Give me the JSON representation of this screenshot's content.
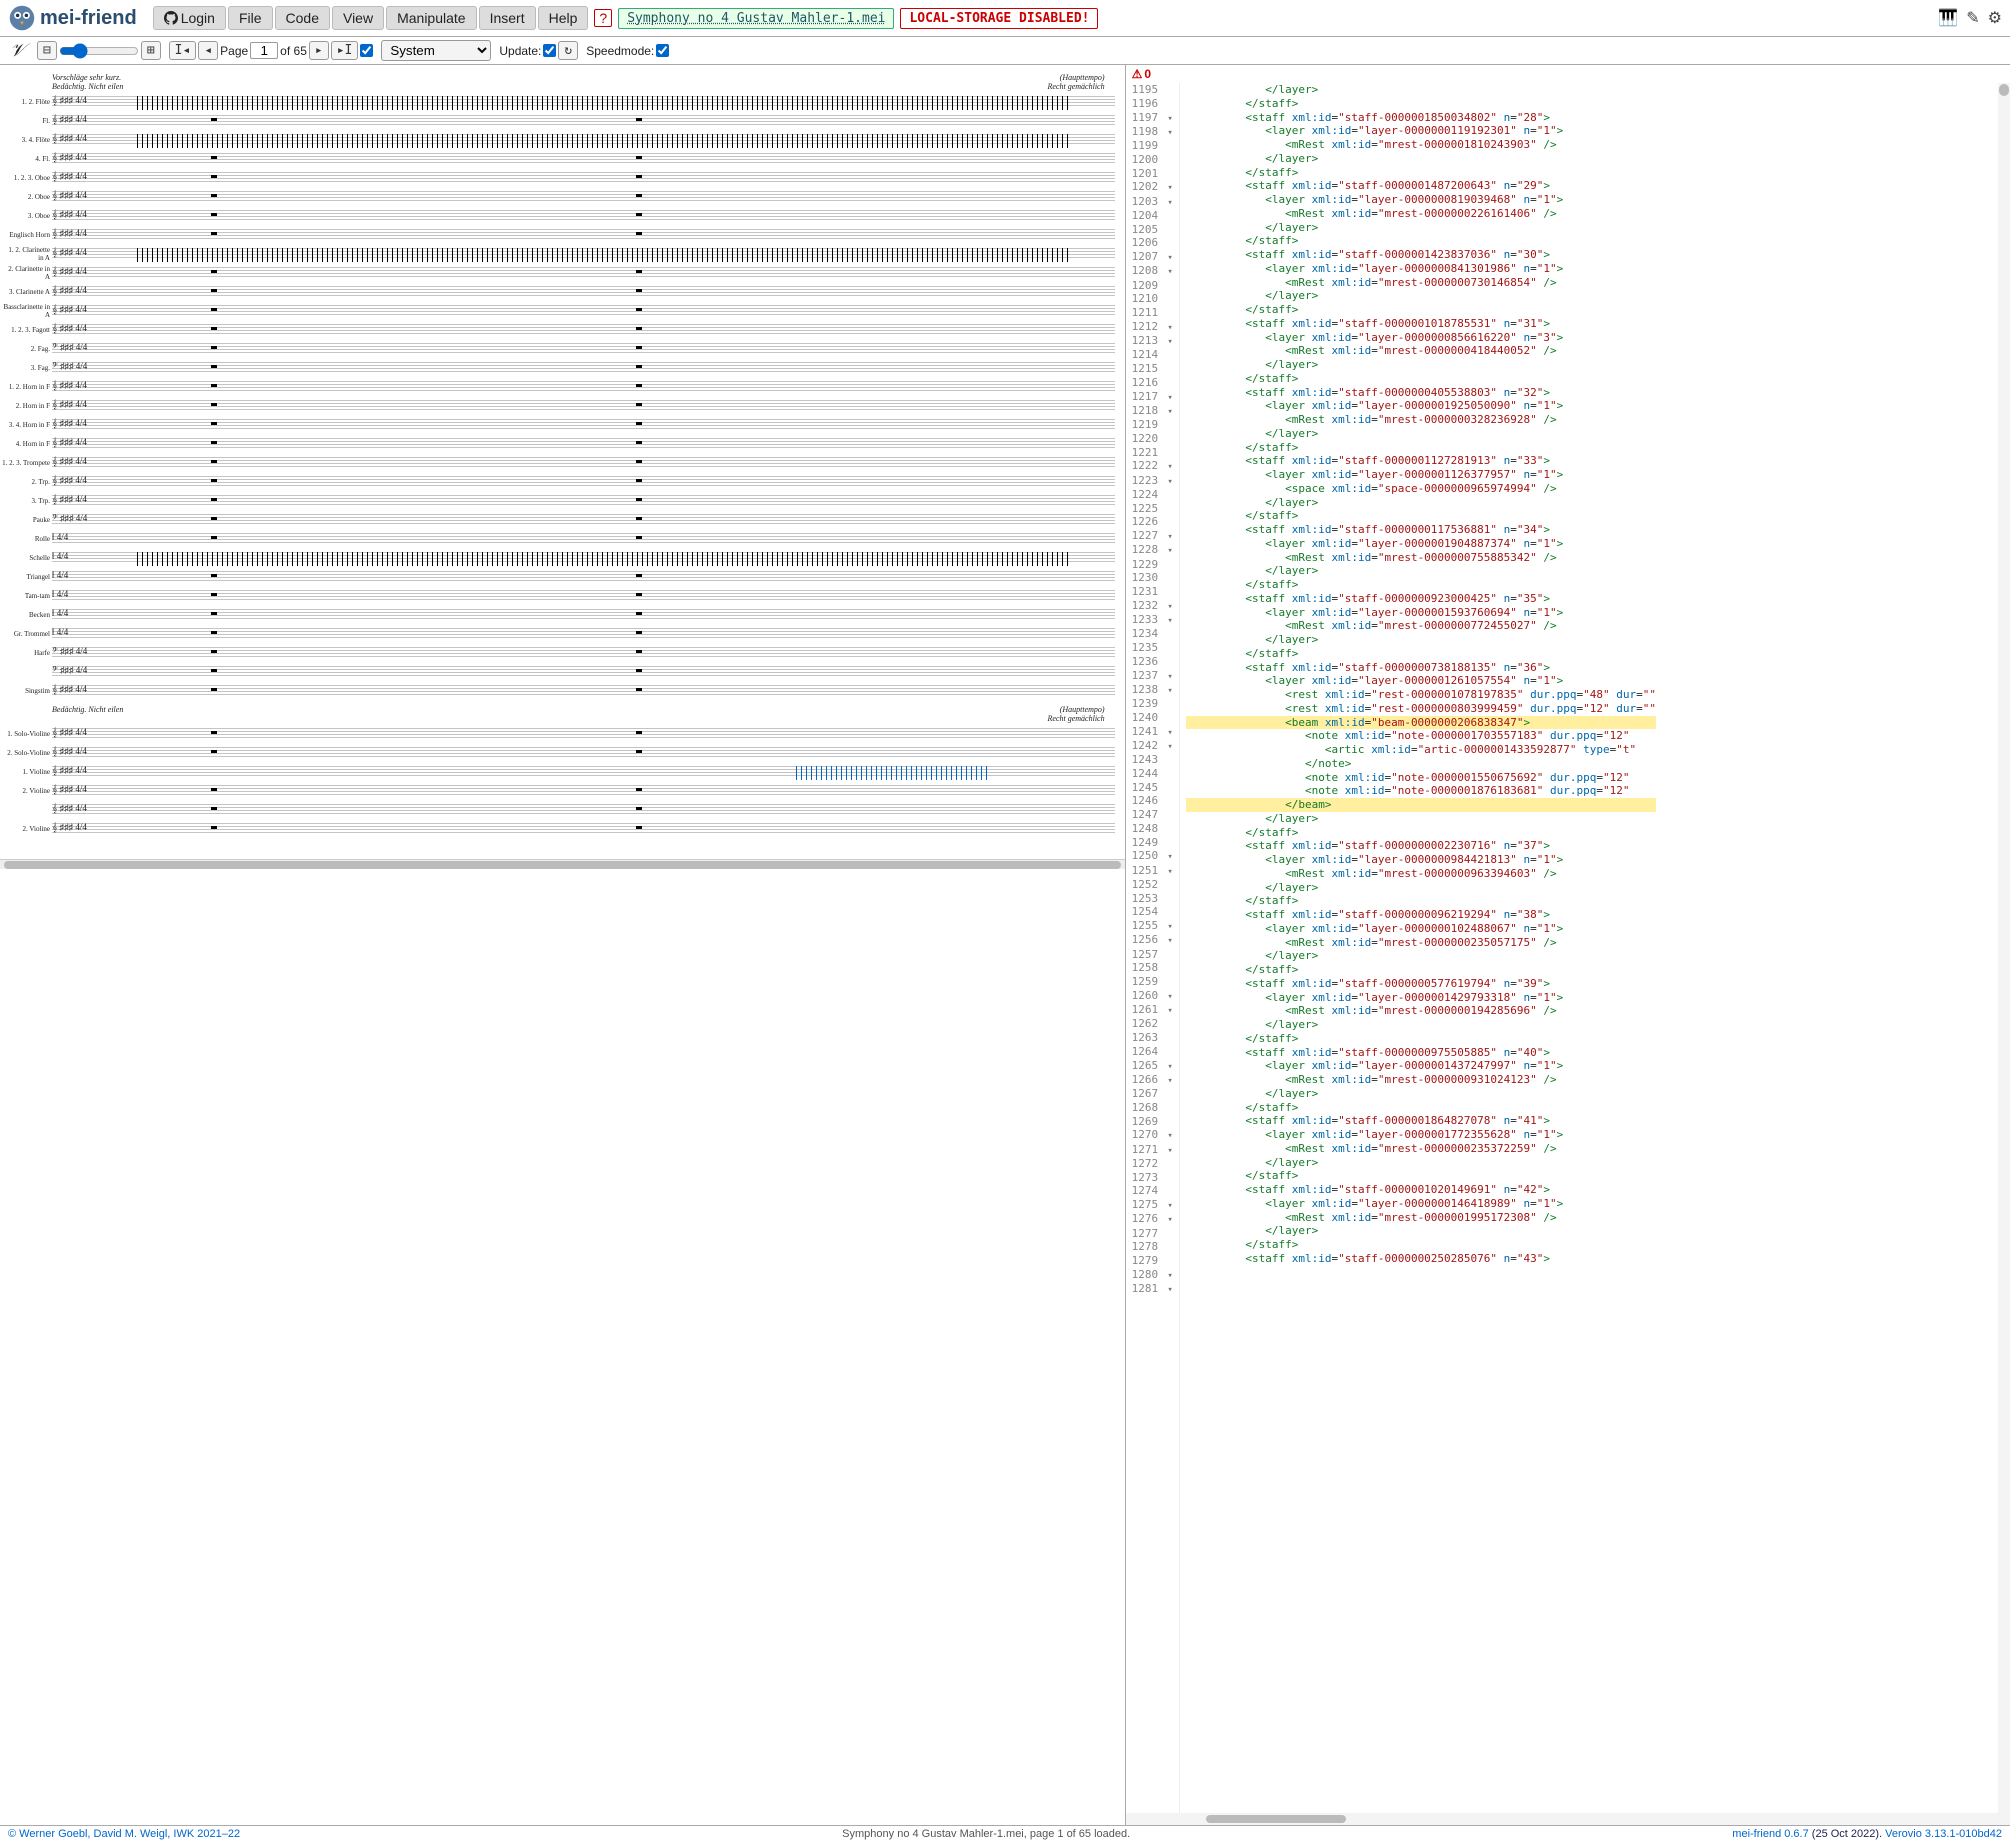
{
  "app_name": "mei-friend",
  "login_label": "Login",
  "menu": [
    "File",
    "Code",
    "View",
    "Manipulate",
    "Insert",
    "Help"
  ],
  "warn_glyph": "?",
  "filename": "Symphony no 4 Gustav Mahler-1.mei",
  "storage_warning": "LOCAL-STORAGE DISABLED!",
  "toolbar": {
    "page_label": "Page",
    "page_value": "1",
    "page_of": "of 65",
    "layout_options": [
      "System"
    ],
    "layout_selected": "System",
    "update_label": "Update:",
    "speed_label": "Speedmode:"
  },
  "errors": {
    "count": "0",
    "glyph": "⚠"
  },
  "tempo_marks": {
    "top_left": "Vorschläge sehr kurz.\nBedächtig. Nicht eilen",
    "top_right": "(Haupttempo)\nRecht gemächlich",
    "mid_left": "Bedächtig. Nicht eilen",
    "mid_right": "(Haupttempo)\nRecht gemächlich"
  },
  "staff_labels": [
    "1. 2. Flöte",
    "Fl.",
    "3. 4. Flöte",
    "4. Fl.",
    "1. 2. 3. Oboe",
    "2. Oboe",
    "3. Oboe",
    "Englisch Horn",
    "1. 2. Clarinette in A",
    "2. Clarinette in A",
    "3. Clarinette A",
    "Bassclarinette in A",
    "1. 2. 3. Fagott",
    "2. Fag.",
    "3. Fag.",
    "1. 2. Horn in F",
    "2. Horn in F",
    "3. 4. Horn in F",
    "4. Horn in F",
    "1. 2. 3. Trompete",
    "2. Trp.",
    "3. Trp.",
    "Pauke",
    "Rolle",
    "Schelle",
    "Triangel",
    "Tam-tam",
    "Becken",
    "Gr. Trommel",
    "Harfe",
    "",
    "Singstim",
    "1. Solo-Violine",
    "2. Solo-Violine",
    "1. Violine",
    "2. Violine",
    "",
    "2. Violine"
  ],
  "code_lines": [
    {
      "n": 1195,
      "indent": 4,
      "html": "</layer>"
    },
    {
      "n": 1196,
      "indent": 3,
      "html": "</staff>"
    },
    {
      "n": 1197,
      "fold": true,
      "indent": 3,
      "tag": "open",
      "el": "staff",
      "attrs": [
        [
          "xml:id",
          "staff-0000001850034802"
        ],
        [
          "n",
          "28"
        ]
      ]
    },
    {
      "n": 1198,
      "fold": true,
      "indent": 4,
      "tag": "open",
      "el": "layer",
      "attrs": [
        [
          "xml:id",
          "layer-0000000119192301"
        ],
        [
          "n",
          "1"
        ]
      ]
    },
    {
      "n": 1199,
      "indent": 5,
      "tag": "self",
      "el": "mRest",
      "attrs": [
        [
          "xml:id",
          "mrest-0000001810243903"
        ]
      ]
    },
    {
      "n": 1200,
      "indent": 4,
      "html": "</layer>"
    },
    {
      "n": 1201,
      "indent": 3,
      "html": "</staff>"
    },
    {
      "n": 1202,
      "fold": true,
      "indent": 3,
      "tag": "open",
      "el": "staff",
      "attrs": [
        [
          "xml:id",
          "staff-0000001487200643"
        ],
        [
          "n",
          "29"
        ]
      ]
    },
    {
      "n": 1203,
      "fold": true,
      "indent": 4,
      "tag": "open",
      "el": "layer",
      "attrs": [
        [
          "xml:id",
          "layer-0000000819039468"
        ],
        [
          "n",
          "1"
        ]
      ]
    },
    {
      "n": 1204,
      "indent": 5,
      "tag": "self",
      "el": "mRest",
      "attrs": [
        [
          "xml:id",
          "mrest-0000000226161406"
        ]
      ]
    },
    {
      "n": 1205,
      "indent": 4,
      "html": "</layer>"
    },
    {
      "n": 1206,
      "indent": 3,
      "html": "</staff>"
    },
    {
      "n": 1207,
      "fold": true,
      "indent": 3,
      "tag": "open",
      "el": "staff",
      "attrs": [
        [
          "xml:id",
          "staff-0000001423837036"
        ],
        [
          "n",
          "30"
        ]
      ]
    },
    {
      "n": 1208,
      "fold": true,
      "indent": 4,
      "tag": "open",
      "el": "layer",
      "attrs": [
        [
          "xml:id",
          "layer-0000000841301986"
        ],
        [
          "n",
          "1"
        ]
      ]
    },
    {
      "n": 1209,
      "indent": 5,
      "tag": "self",
      "el": "mRest",
      "attrs": [
        [
          "xml:id",
          "mrest-0000000730146854"
        ]
      ]
    },
    {
      "n": 1210,
      "indent": 4,
      "html": "</layer>"
    },
    {
      "n": 1211,
      "indent": 3,
      "html": "</staff>"
    },
    {
      "n": 1212,
      "fold": true,
      "indent": 3,
      "tag": "open",
      "el": "staff",
      "attrs": [
        [
          "xml:id",
          "staff-0000001018785531"
        ],
        [
          "n",
          "31"
        ]
      ]
    },
    {
      "n": 1213,
      "fold": true,
      "indent": 4,
      "tag": "open",
      "el": "layer",
      "attrs": [
        [
          "xml:id",
          "layer-0000000856616220"
        ],
        [
          "n",
          "3"
        ]
      ]
    },
    {
      "n": 1214,
      "indent": 5,
      "tag": "self",
      "el": "mRest",
      "attrs": [
        [
          "xml:id",
          "mrest-0000000418440052"
        ]
      ]
    },
    {
      "n": 1215,
      "indent": 4,
      "html": "</layer>"
    },
    {
      "n": 1216,
      "indent": 3,
      "html": "</staff>"
    },
    {
      "n": 1217,
      "fold": true,
      "indent": 3,
      "tag": "open",
      "el": "staff",
      "attrs": [
        [
          "xml:id",
          "staff-0000000405538803"
        ],
        [
          "n",
          "32"
        ]
      ]
    },
    {
      "n": 1218,
      "fold": true,
      "indent": 4,
      "tag": "open",
      "el": "layer",
      "attrs": [
        [
          "xml:id",
          "layer-0000001925050090"
        ],
        [
          "n",
          "1"
        ]
      ]
    },
    {
      "n": 1219,
      "indent": 5,
      "tag": "self",
      "el": "mRest",
      "attrs": [
        [
          "xml:id",
          "mrest-0000000328236928"
        ]
      ]
    },
    {
      "n": 1220,
      "indent": 4,
      "html": "</layer>"
    },
    {
      "n": 1221,
      "indent": 3,
      "html": "</staff>"
    },
    {
      "n": 1222,
      "fold": true,
      "indent": 3,
      "tag": "open",
      "el": "staff",
      "attrs": [
        [
          "xml:id",
          "staff-0000001127281913"
        ],
        [
          "n",
          "33"
        ]
      ]
    },
    {
      "n": 1223,
      "fold": true,
      "indent": 4,
      "tag": "open",
      "el": "layer",
      "attrs": [
        [
          "xml:id",
          "layer-0000001126377957"
        ],
        [
          "n",
          "1"
        ]
      ]
    },
    {
      "n": 1224,
      "indent": 5,
      "tag": "self",
      "el": "space",
      "attrs": [
        [
          "xml:id",
          "space-0000000965974994"
        ]
      ]
    },
    {
      "n": 1225,
      "indent": 4,
      "html": "</layer>"
    },
    {
      "n": 1226,
      "indent": 3,
      "html": "</staff>"
    },
    {
      "n": 1227,
      "fold": true,
      "indent": 3,
      "tag": "open",
      "el": "staff",
      "attrs": [
        [
          "xml:id",
          "staff-0000000117536881"
        ],
        [
          "n",
          "34"
        ]
      ]
    },
    {
      "n": 1228,
      "fold": true,
      "indent": 4,
      "tag": "open",
      "el": "layer",
      "attrs": [
        [
          "xml:id",
          "layer-0000001904887374"
        ],
        [
          "n",
          "1"
        ]
      ]
    },
    {
      "n": 1229,
      "indent": 5,
      "tag": "self",
      "el": "mRest",
      "attrs": [
        [
          "xml:id",
          "mrest-0000000755885342"
        ]
      ]
    },
    {
      "n": 1230,
      "indent": 4,
      "html": "</layer>"
    },
    {
      "n": 1231,
      "indent": 3,
      "html": "</staff>"
    },
    {
      "n": 1232,
      "fold": true,
      "indent": 3,
      "tag": "open",
      "el": "staff",
      "attrs": [
        [
          "xml:id",
          "staff-0000000923000425"
        ],
        [
          "n",
          "35"
        ]
      ]
    },
    {
      "n": 1233,
      "fold": true,
      "indent": 4,
      "tag": "open",
      "el": "layer",
      "attrs": [
        [
          "xml:id",
          "layer-0000001593760694"
        ],
        [
          "n",
          "1"
        ]
      ]
    },
    {
      "n": 1234,
      "indent": 5,
      "tag": "self",
      "el": "mRest",
      "attrs": [
        [
          "xml:id",
          "mrest-0000000772455027"
        ]
      ]
    },
    {
      "n": 1235,
      "indent": 4,
      "html": "</layer>"
    },
    {
      "n": 1236,
      "indent": 3,
      "html": "</staff>"
    },
    {
      "n": 1237,
      "fold": true,
      "indent": 3,
      "tag": "open",
      "el": "staff",
      "attrs": [
        [
          "xml:id",
          "staff-0000000738188135"
        ],
        [
          "n",
          "36"
        ]
      ]
    },
    {
      "n": 1238,
      "fold": true,
      "indent": 4,
      "tag": "open",
      "el": "layer",
      "attrs": [
        [
          "xml:id",
          "layer-0000001261057554"
        ],
        [
          "n",
          "1"
        ]
      ]
    },
    {
      "n": 1239,
      "indent": 5,
      "tag": "open_trail",
      "el": "rest",
      "attrs": [
        [
          "xml:id",
          "rest-0000001078197835"
        ],
        [
          "dur.ppq",
          "48"
        ],
        [
          "dur",
          ""
        ]
      ],
      "trail": true
    },
    {
      "n": 1240,
      "indent": 5,
      "tag": "open_trail",
      "el": "rest",
      "attrs": [
        [
          "xml:id",
          "rest-0000000803999459"
        ],
        [
          "dur.ppq",
          "12"
        ],
        [
          "dur",
          ""
        ]
      ],
      "trail": true
    },
    {
      "n": 1241,
      "fold": true,
      "indent": 5,
      "hl": true,
      "tag": "open",
      "el": "beam",
      "attrs": [
        [
          "xml:id",
          "beam-0000000206838347"
        ]
      ]
    },
    {
      "n": 1242,
      "fold": true,
      "indent": 6,
      "tag": "open_trail",
      "el": "note",
      "attrs": [
        [
          "xml:id",
          "note-0000001703557183"
        ],
        [
          "dur.ppq",
          "12"
        ]
      ],
      "trail": true
    },
    {
      "n": 1243,
      "indent": 7,
      "tag": "open_trail",
      "el": "artic",
      "attrs": [
        [
          "xml:id",
          "artic-0000001433592877"
        ],
        [
          "type",
          "t"
        ]
      ],
      "trail": true
    },
    {
      "n": 1244,
      "indent": 6,
      "html": "</note>"
    },
    {
      "n": 1245,
      "indent": 6,
      "tag": "open_trail",
      "el": "note",
      "attrs": [
        [
          "xml:id",
          "note-0000001550675692"
        ],
        [
          "dur.ppq",
          "12"
        ]
      ],
      "trail": true
    },
    {
      "n": 1246,
      "indent": 6,
      "tag": "open_trail",
      "el": "note",
      "attrs": [
        [
          "xml:id",
          "note-0000001876183681"
        ],
        [
          "dur.ppq",
          "12"
        ]
      ],
      "trail": true
    },
    {
      "n": 1247,
      "indent": 5,
      "hl": true,
      "html": "</beam>"
    },
    {
      "n": 1248,
      "indent": 4,
      "html": "</layer>"
    },
    {
      "n": 1249,
      "indent": 3,
      "html": "</staff>"
    },
    {
      "n": 1250,
      "fold": true,
      "indent": 3,
      "tag": "open",
      "el": "staff",
      "attrs": [
        [
          "xml:id",
          "staff-0000000002230716"
        ],
        [
          "n",
          "37"
        ]
      ]
    },
    {
      "n": 1251,
      "fold": true,
      "indent": 4,
      "tag": "open",
      "el": "layer",
      "attrs": [
        [
          "xml:id",
          "layer-0000000984421813"
        ],
        [
          "n",
          "1"
        ]
      ]
    },
    {
      "n": 1252,
      "indent": 5,
      "tag": "self",
      "el": "mRest",
      "attrs": [
        [
          "xml:id",
          "mrest-0000000963394603"
        ]
      ]
    },
    {
      "n": 1253,
      "indent": 4,
      "html": "</layer>"
    },
    {
      "n": 1254,
      "indent": 3,
      "html": "</staff>"
    },
    {
      "n": 1255,
      "fold": true,
      "indent": 3,
      "tag": "open",
      "el": "staff",
      "attrs": [
        [
          "xml:id",
          "staff-0000000096219294"
        ],
        [
          "n",
          "38"
        ]
      ]
    },
    {
      "n": 1256,
      "fold": true,
      "indent": 4,
      "tag": "open",
      "el": "layer",
      "attrs": [
        [
          "xml:id",
          "layer-0000000102488067"
        ],
        [
          "n",
          "1"
        ]
      ]
    },
    {
      "n": 1257,
      "indent": 5,
      "tag": "self",
      "el": "mRest",
      "attrs": [
        [
          "xml:id",
          "mrest-0000000235057175"
        ]
      ]
    },
    {
      "n": 1258,
      "indent": 4,
      "html": "</layer>"
    },
    {
      "n": 1259,
      "indent": 3,
      "html": "</staff>"
    },
    {
      "n": 1260,
      "fold": true,
      "indent": 3,
      "tag": "open",
      "el": "staff",
      "attrs": [
        [
          "xml:id",
          "staff-0000000577619794"
        ],
        [
          "n",
          "39"
        ]
      ]
    },
    {
      "n": 1261,
      "fold": true,
      "indent": 4,
      "tag": "open",
      "el": "layer",
      "attrs": [
        [
          "xml:id",
          "layer-0000001429793318"
        ],
        [
          "n",
          "1"
        ]
      ]
    },
    {
      "n": 1262,
      "indent": 5,
      "tag": "self",
      "el": "mRest",
      "attrs": [
        [
          "xml:id",
          "mrest-0000000194285696"
        ]
      ]
    },
    {
      "n": 1263,
      "indent": 4,
      "html": "</layer>"
    },
    {
      "n": 1264,
      "indent": 3,
      "html": "</staff>"
    },
    {
      "n": 1265,
      "fold": true,
      "indent": 3,
      "tag": "open",
      "el": "staff",
      "attrs": [
        [
          "xml:id",
          "staff-0000000975505885"
        ],
        [
          "n",
          "40"
        ]
      ]
    },
    {
      "n": 1266,
      "fold": true,
      "indent": 4,
      "tag": "open",
      "el": "layer",
      "attrs": [
        [
          "xml:id",
          "layer-0000001437247997"
        ],
        [
          "n",
          "1"
        ]
      ]
    },
    {
      "n": 1267,
      "indent": 5,
      "tag": "self",
      "el": "mRest",
      "attrs": [
        [
          "xml:id",
          "mrest-0000000931024123"
        ]
      ]
    },
    {
      "n": 1268,
      "indent": 4,
      "html": "</layer>"
    },
    {
      "n": 1269,
      "indent": 3,
      "html": "</staff>"
    },
    {
      "n": 1270,
      "fold": true,
      "indent": 3,
      "tag": "open",
      "el": "staff",
      "attrs": [
        [
          "xml:id",
          "staff-0000001864827078"
        ],
        [
          "n",
          "41"
        ]
      ]
    },
    {
      "n": 1271,
      "fold": true,
      "indent": 4,
      "tag": "open",
      "el": "layer",
      "attrs": [
        [
          "xml:id",
          "layer-0000001772355628"
        ],
        [
          "n",
          "1"
        ]
      ]
    },
    {
      "n": 1272,
      "indent": 5,
      "tag": "self",
      "el": "mRest",
      "attrs": [
        [
          "xml:id",
          "mrest-0000000235372259"
        ]
      ]
    },
    {
      "n": 1273,
      "indent": 4,
      "html": "</layer>"
    },
    {
      "n": 1274,
      "indent": 3,
      "html": "</staff>"
    },
    {
      "n": 1275,
      "fold": true,
      "indent": 3,
      "tag": "open",
      "el": "staff",
      "attrs": [
        [
          "xml:id",
          "staff-0000001020149691"
        ],
        [
          "n",
          "42"
        ]
      ]
    },
    {
      "n": 1276,
      "fold": true,
      "indent": 4,
      "tag": "open",
      "el": "layer",
      "attrs": [
        [
          "xml:id",
          "layer-0000000146418989"
        ],
        [
          "n",
          "1"
        ]
      ]
    },
    {
      "n": 1277,
      "indent": 5,
      "tag": "self",
      "el": "mRest",
      "attrs": [
        [
          "xml:id",
          "mrest-0000001995172308"
        ]
      ]
    },
    {
      "n": 1278,
      "indent": 4,
      "html": "</layer>"
    },
    {
      "n": 1279,
      "indent": 3,
      "html": "</staff>"
    },
    {
      "n": 1280,
      "fold": true,
      "indent": 3,
      "tag": "open",
      "el": "staff",
      "attrs": [
        [
          "xml:id",
          "staff-0000000250285076"
        ],
        [
          "n",
          "43"
        ]
      ]
    },
    {
      "n": 1281,
      "fold": true,
      "indent": 4,
      "html": ""
    }
  ],
  "status": {
    "left": "© Werner Goebl, David M. Weigl, IWK 2021–22",
    "center": "Symphony no 4 Gustav Mahler-1.mei, page 1 of 65 loaded.",
    "right_app": "mei-friend 0.6.7",
    "right_date": " (25 Oct 2022). ",
    "right_engine": "Verovio 3.13.1-010bd42"
  }
}
